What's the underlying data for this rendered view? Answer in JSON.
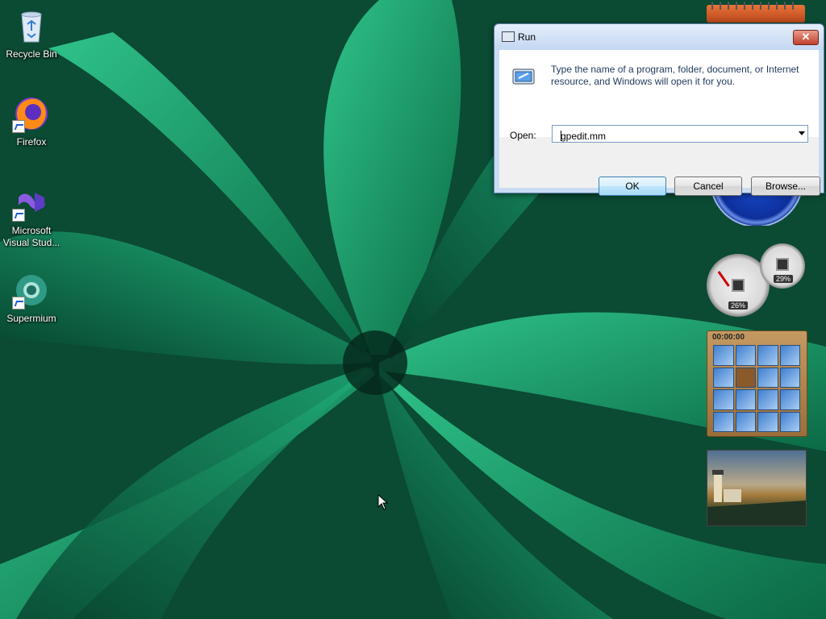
{
  "desktop": {
    "icons": [
      {
        "label": "Recycle Bin",
        "icon": "recycle-bin-icon"
      },
      {
        "label": "Firefox",
        "icon": "firefox-icon"
      },
      {
        "label": "Microsoft Visual Stud...",
        "icon": "visual-studio-icon"
      },
      {
        "label": "Supermium",
        "icon": "supermium-icon"
      }
    ]
  },
  "run_dialog": {
    "title": "Run",
    "description": "Type the name of a program, folder, document, or Internet resource, and Windows will open it for you.",
    "open_label": "Open:",
    "open_value": "gpedit.mm",
    "ok_label": "OK",
    "cancel_label": "Cancel",
    "browse_label": "Browse...",
    "close_glyph": "✕"
  },
  "gadgets": {
    "cpu_meter": {
      "cpu_percent": "26%",
      "memory_percent": "29%"
    },
    "puzzle": {
      "timer": "00:00:00"
    }
  },
  "colors": {
    "accent": "#3c7fb1",
    "wallpaper_green": "#0f8a57"
  }
}
